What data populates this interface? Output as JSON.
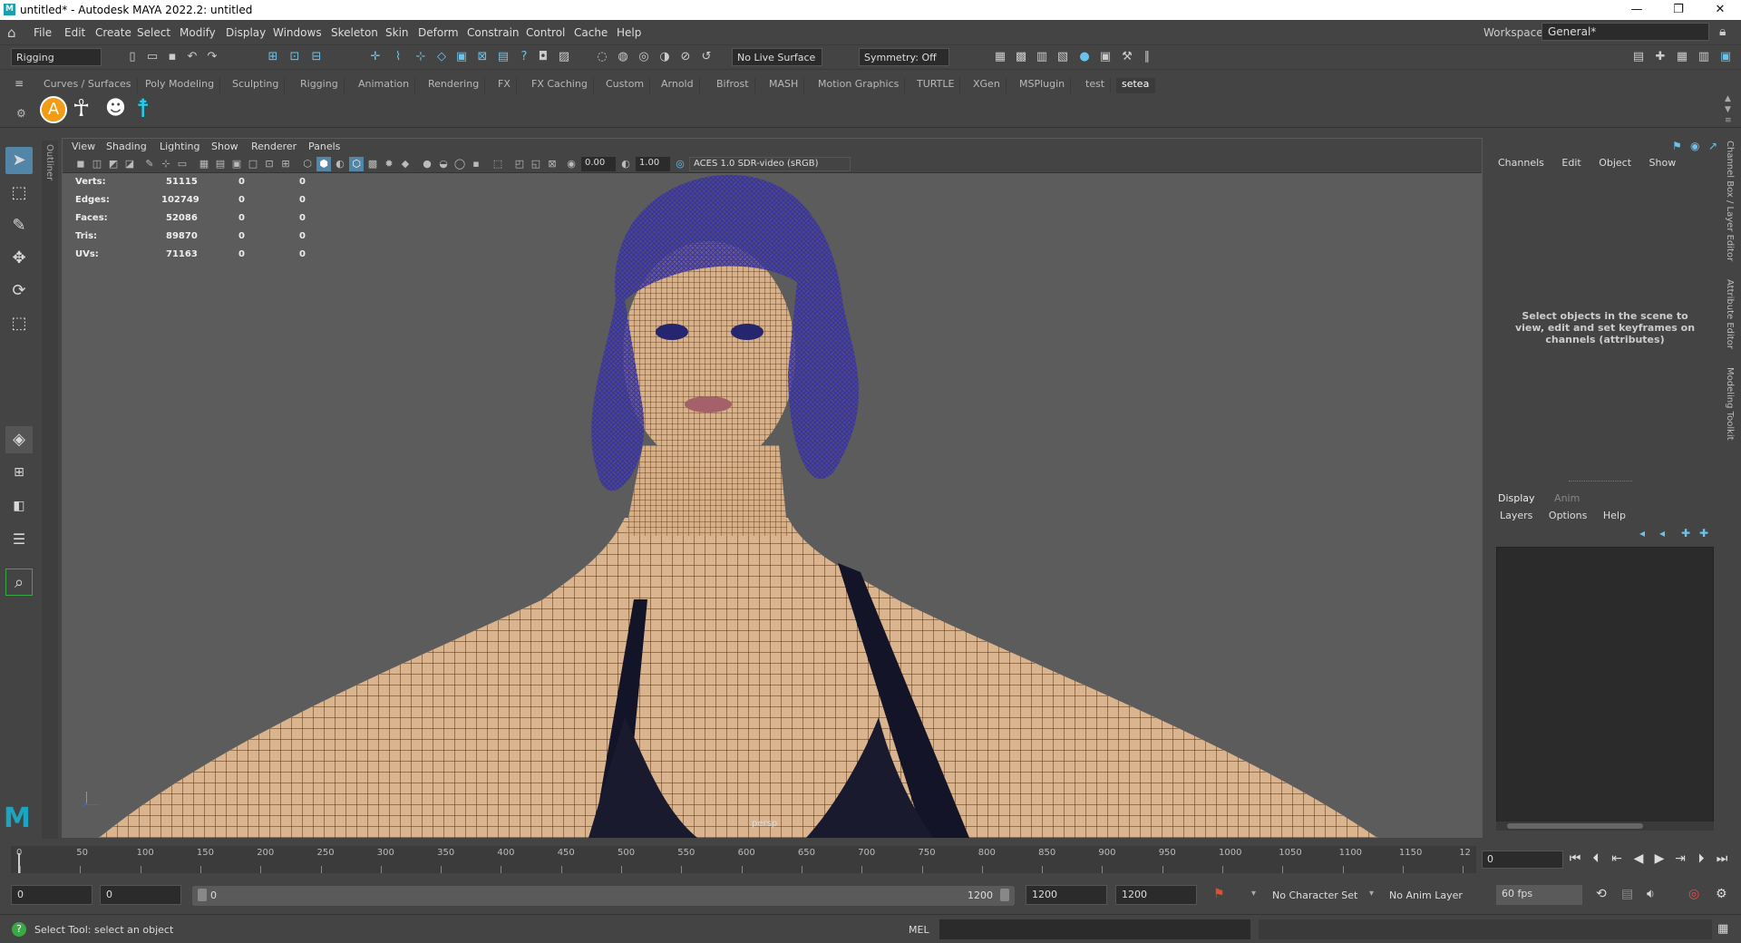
{
  "window": {
    "title": "untitled* - Autodesk MAYA 2022.2: untitled",
    "minimize": "—",
    "restore": "❐",
    "close": "✕"
  },
  "menu": [
    "File",
    "Edit",
    "Create",
    "Select",
    "Modify",
    "Display",
    "Windows",
    "Skeleton",
    "Skin",
    "Deform",
    "Constrain",
    "Control",
    "Cache",
    "Help"
  ],
  "workspace": {
    "label": "Workspace:",
    "value": "General*"
  },
  "statusline": {
    "menuset": "Rigging",
    "live_surface": "No Live Surface",
    "symmetry": "Symmetry: Off"
  },
  "shelf_tabs": [
    "Curves / Surfaces",
    "Poly Modeling",
    "Sculpting",
    "Rigging",
    "Animation",
    "Rendering",
    "FX",
    "FX Caching",
    "Custom",
    "Arnold",
    "Bifrost",
    "MASH",
    "Motion Graphics",
    "TURTLE",
    "XGen",
    "MSPlugin",
    "test",
    "setea"
  ],
  "active_shelf": "setea",
  "outliner_label": "Outliner",
  "panel_menu": [
    "View",
    "Shading",
    "Lighting",
    "Show",
    "Renderer",
    "Panels"
  ],
  "panel_fields": {
    "exposure": "0.00",
    "gamma": "1.00",
    "colorspace": "ACES 1.0 SDR-video (sRGB)"
  },
  "hud": [
    {
      "label": "Verts:",
      "a": "51115",
      "b": "0",
      "c": "0"
    },
    {
      "label": "Edges:",
      "a": "102749",
      "b": "0",
      "c": "0"
    },
    {
      "label": "Faces:",
      "a": "52086",
      "b": "0",
      "c": "0"
    },
    {
      "label": "Tris:",
      "a": "89870",
      "b": "0",
      "c": "0"
    },
    {
      "label": "UVs:",
      "a": "71163",
      "b": "0",
      "c": "0"
    }
  ],
  "camera_label": "persp",
  "channel_box": {
    "menu": [
      "Channels",
      "Edit",
      "Object",
      "Show"
    ],
    "message": "Select objects in the scene to view, edit and set keyframes on channels (attributes)"
  },
  "side_tabs": [
    "Channel Box / Layer Editor",
    "Attribute Editor",
    "Modeling Toolkit"
  ],
  "layer_editor": {
    "tabs": [
      "Display",
      "Anim"
    ],
    "menu": [
      "Layers",
      "Options",
      "Help"
    ]
  },
  "timeline": {
    "ticks": [
      "0",
      "50",
      "100",
      "150",
      "200",
      "250",
      "300",
      "350",
      "400",
      "450",
      "500",
      "550",
      "600",
      "650",
      "700",
      "750",
      "800",
      "850",
      "900",
      "950",
      "1000",
      "1050",
      "1100",
      "1150",
      "12"
    ],
    "current_frame": "0"
  },
  "range": {
    "start": "0",
    "anim_start": "0",
    "slider_start": "0",
    "slider_end": "1200",
    "anim_end": "1200",
    "end": "1200",
    "character_set": "No Character Set",
    "anim_layer": "No Anim Layer",
    "fps": "60 fps"
  },
  "command": {
    "help": "Select Tool: select an object",
    "mel": "MEL"
  },
  "colors": {
    "accent": "#1ba5c0",
    "selected_tool": "#5285a6",
    "wire": "#2a2a8a",
    "skin": "#d9b48f"
  }
}
